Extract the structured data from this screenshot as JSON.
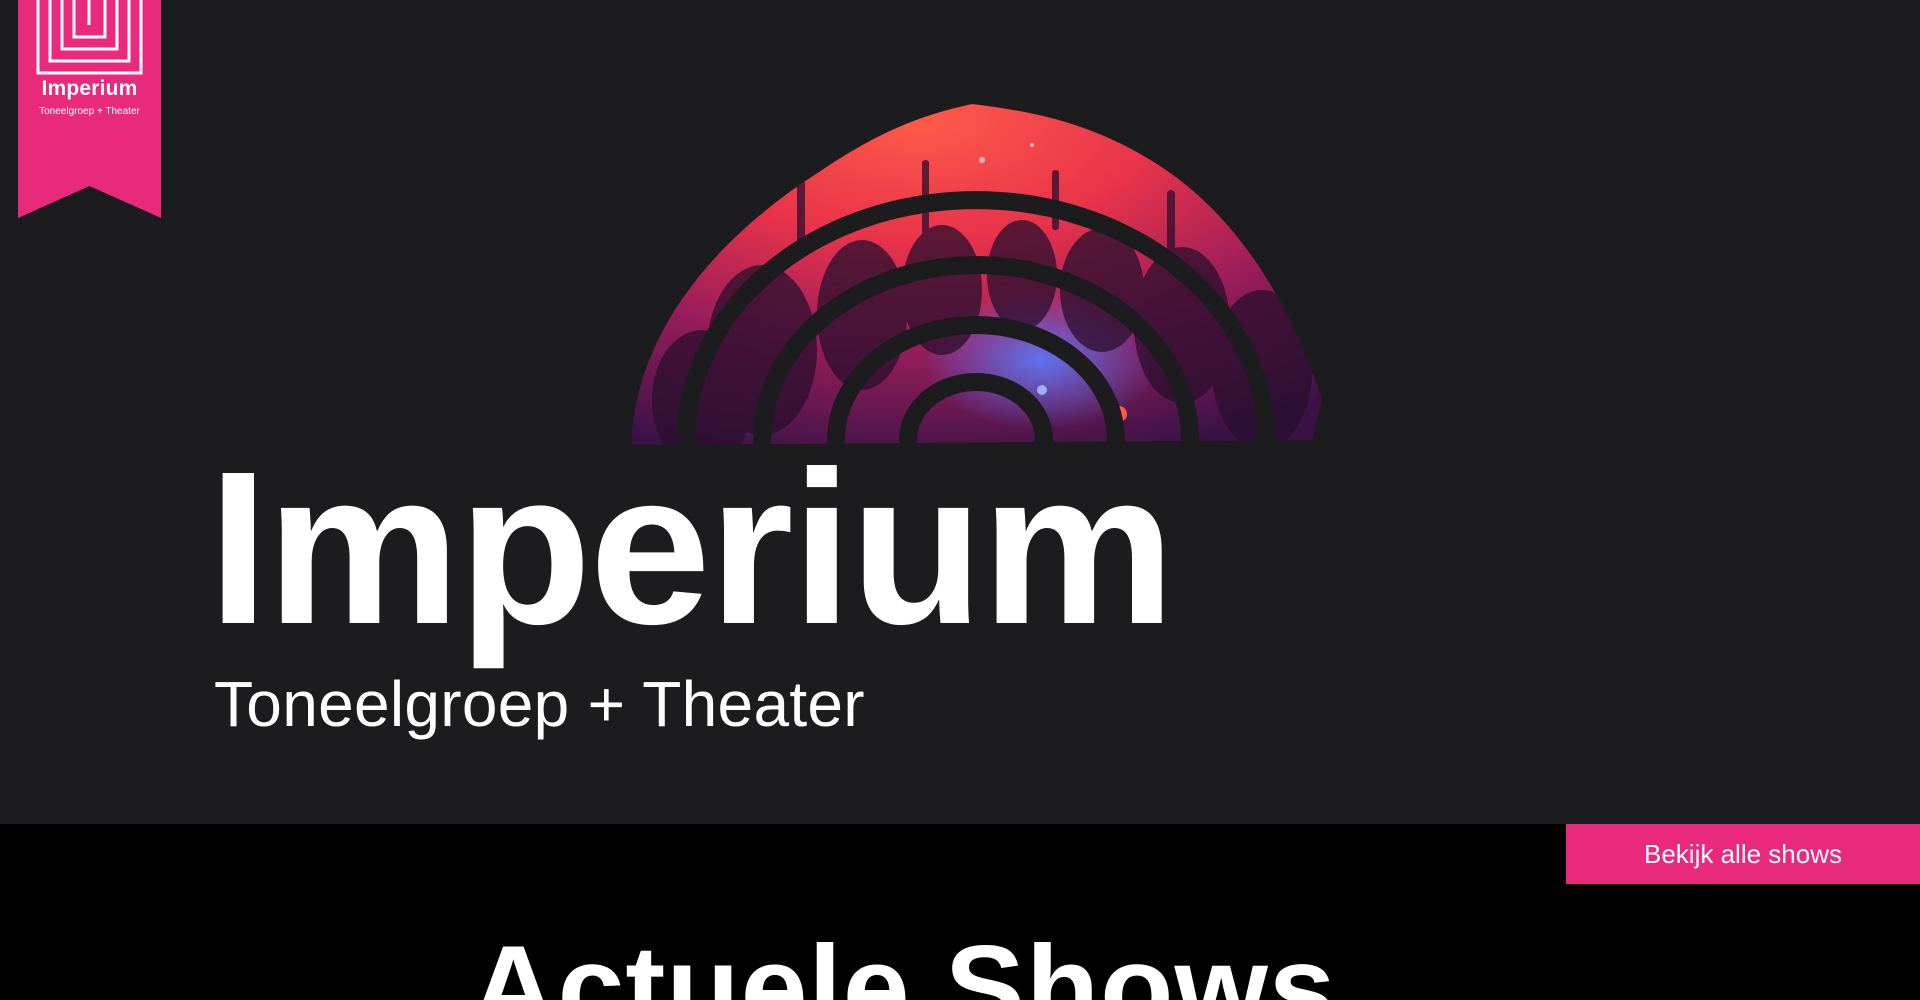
{
  "brand": {
    "name": "Imperium",
    "tagline": "Toneelgroep + Theater",
    "accent_color": "#e8297c",
    "background_color": "#1c1c1e"
  },
  "hero": {
    "title": "Imperium",
    "subtitle": "Toneelgroep + Theater",
    "image": "concert-crowd-arc"
  },
  "shows": {
    "button_label": "Bekijk alle shows",
    "heading": "Actuele Shows"
  }
}
